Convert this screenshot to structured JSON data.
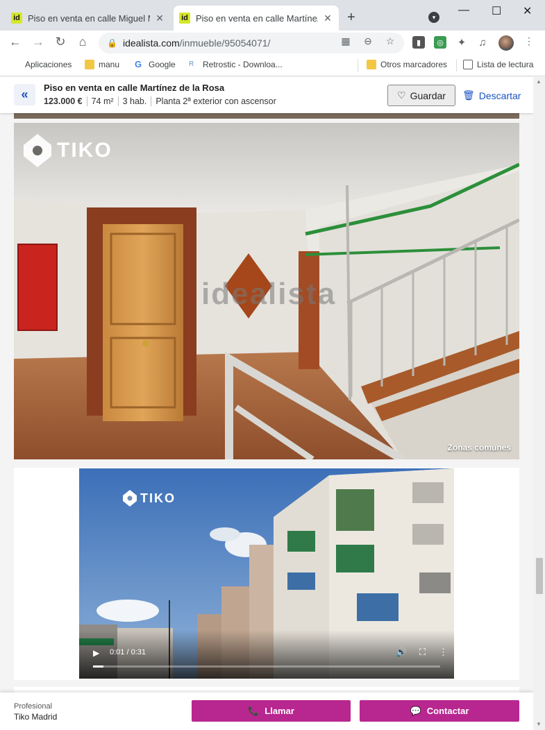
{
  "browser": {
    "tabs": [
      {
        "favicon": "id",
        "title": "Piso en venta en calle Miguel Mo",
        "active": false
      },
      {
        "favicon": "id",
        "title": "Piso en venta en calle Martínez d",
        "active": true
      }
    ],
    "new_tab": "+",
    "url_host": "idealista.com",
    "url_path": "/inmueble/95054071/",
    "bookmarks": [
      {
        "label": "Aplicaciones",
        "icon": "apps-grid-icon"
      },
      {
        "label": "manu",
        "icon": "folder-icon"
      },
      {
        "label": "Google",
        "icon": "google-icon"
      },
      {
        "label": "Retrostic - Downloa...",
        "icon": "retrostic-icon"
      },
      {
        "label": "Otros marcadores",
        "icon": "folder-icon"
      },
      {
        "label": "Lista de lectura",
        "icon": "reading-list-icon"
      }
    ]
  },
  "listing": {
    "back_icon": "«",
    "title": "Piso en venta en calle Martínez de la Rosa",
    "price": "123.000 €",
    "area": "74 m²",
    "rooms": "3 hab.",
    "floor": "Planta 2ª exterior con ascensor",
    "save_label": "Guardar",
    "discard_label": "Descartar"
  },
  "photo": {
    "brand": "TIKO",
    "watermark": "idealista",
    "caption": "Zonas comunes"
  },
  "video": {
    "brand": "TIKO",
    "time": "0:01 / 0:31",
    "progress": 0.03
  },
  "footer": {
    "role": "Profesional",
    "agency": "Tiko Madrid",
    "call_label": "Llamar",
    "contact_label": "Contactar"
  },
  "colors": {
    "accent": "#1a51c4",
    "cta": "#b8268f"
  }
}
